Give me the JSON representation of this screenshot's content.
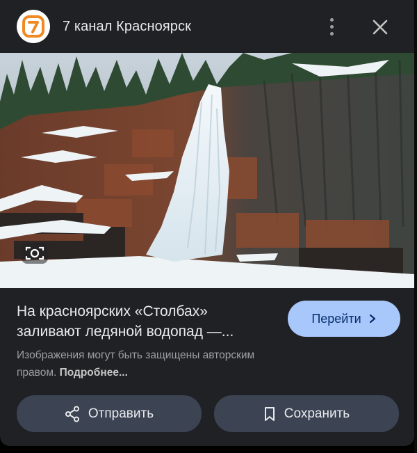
{
  "header": {
    "logo_text": "7",
    "source_name": "7 канал Красноярск",
    "logo_color": "#f08a24"
  },
  "image": {
    "description_icon": "lens-icon"
  },
  "result": {
    "caption_line1": "На красноярских «Столбах»",
    "caption_line2": "заливают ледяной водопад —...",
    "visit_label": "Перейти",
    "copyright_line1": "Изображения могут быть защищены авторским",
    "copyright_prefix": "правом.",
    "more_label": "Подробнее..."
  },
  "actions": {
    "share_label": "Отправить",
    "save_label": "Сохранить"
  },
  "colors": {
    "panel": "#202124",
    "accent": "#a8c7fa",
    "button": "#3c4453"
  }
}
